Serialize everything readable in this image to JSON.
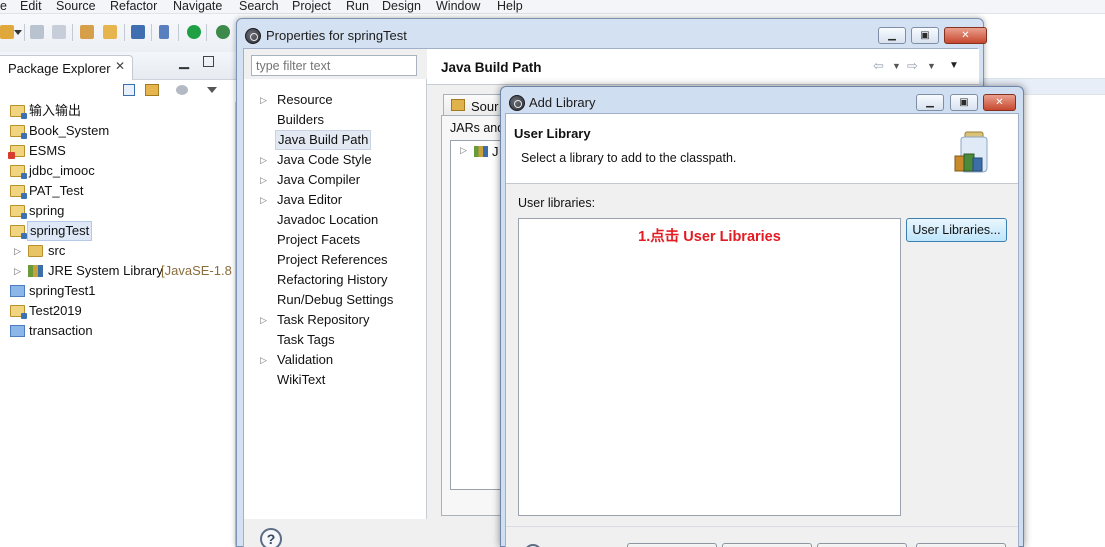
{
  "menubar": {
    "items": [
      "e",
      "Edit",
      "Source",
      "Refactor",
      "Navigate",
      "Search",
      "Project",
      "Run",
      "Design",
      "Window",
      "Help"
    ]
  },
  "package_explorer": {
    "tab_label": "Package Explorer",
    "close_glyph": "✕",
    "items": [
      {
        "label": "输入输出"
      },
      {
        "label": "Book_System"
      },
      {
        "label": "ESMS"
      },
      {
        "label": "jdbc_imooc"
      },
      {
        "label": "PAT_Test"
      },
      {
        "label": "spring"
      },
      {
        "label": "springTest"
      },
      {
        "label": "src"
      },
      {
        "label": "JRE System Library",
        "decoration": "[JavaSE-1.8"
      },
      {
        "label": "springTest1"
      },
      {
        "label": "Test2019"
      },
      {
        "label": "transaction"
      }
    ]
  },
  "properties_dialog": {
    "title": "Properties for springTest",
    "filter_placeholder": "type filter text",
    "nav_items": [
      {
        "label": "Resource",
        "expandable": true
      },
      {
        "label": "Builders",
        "expandable": false
      },
      {
        "label": "Java Build Path",
        "expandable": false,
        "selected": true
      },
      {
        "label": "Java Code Style",
        "expandable": true
      },
      {
        "label": "Java Compiler",
        "expandable": true
      },
      {
        "label": "Java Editor",
        "expandable": true
      },
      {
        "label": "Javadoc Location",
        "expandable": false
      },
      {
        "label": "Project Facets",
        "expandable": false
      },
      {
        "label": "Project References",
        "expandable": false
      },
      {
        "label": "Refactoring History",
        "expandable": false
      },
      {
        "label": "Run/Debug Settings",
        "expandable": false
      },
      {
        "label": "Task Repository",
        "expandable": true
      },
      {
        "label": "Task Tags",
        "expandable": false
      },
      {
        "label": "Validation",
        "expandable": true
      },
      {
        "label": "WikiText",
        "expandable": false
      }
    ],
    "page_title": "Java Build Path",
    "source_tab": "Sour",
    "jars_label": "JARs and",
    "jars_tree_item": "J",
    "help_glyph": "?"
  },
  "add_library_dialog": {
    "title": "Add Library",
    "heading": "User Library",
    "description": "Select a library to add to the classpath.",
    "list_label": "User libraries:",
    "annotation": "1.点击 User Libraries",
    "user_libraries_button": "User Libraries..."
  },
  "colors": {
    "annotation": "#e21c22",
    "title_bar": "#d4e1f2",
    "selection": "#dfe8f6"
  }
}
